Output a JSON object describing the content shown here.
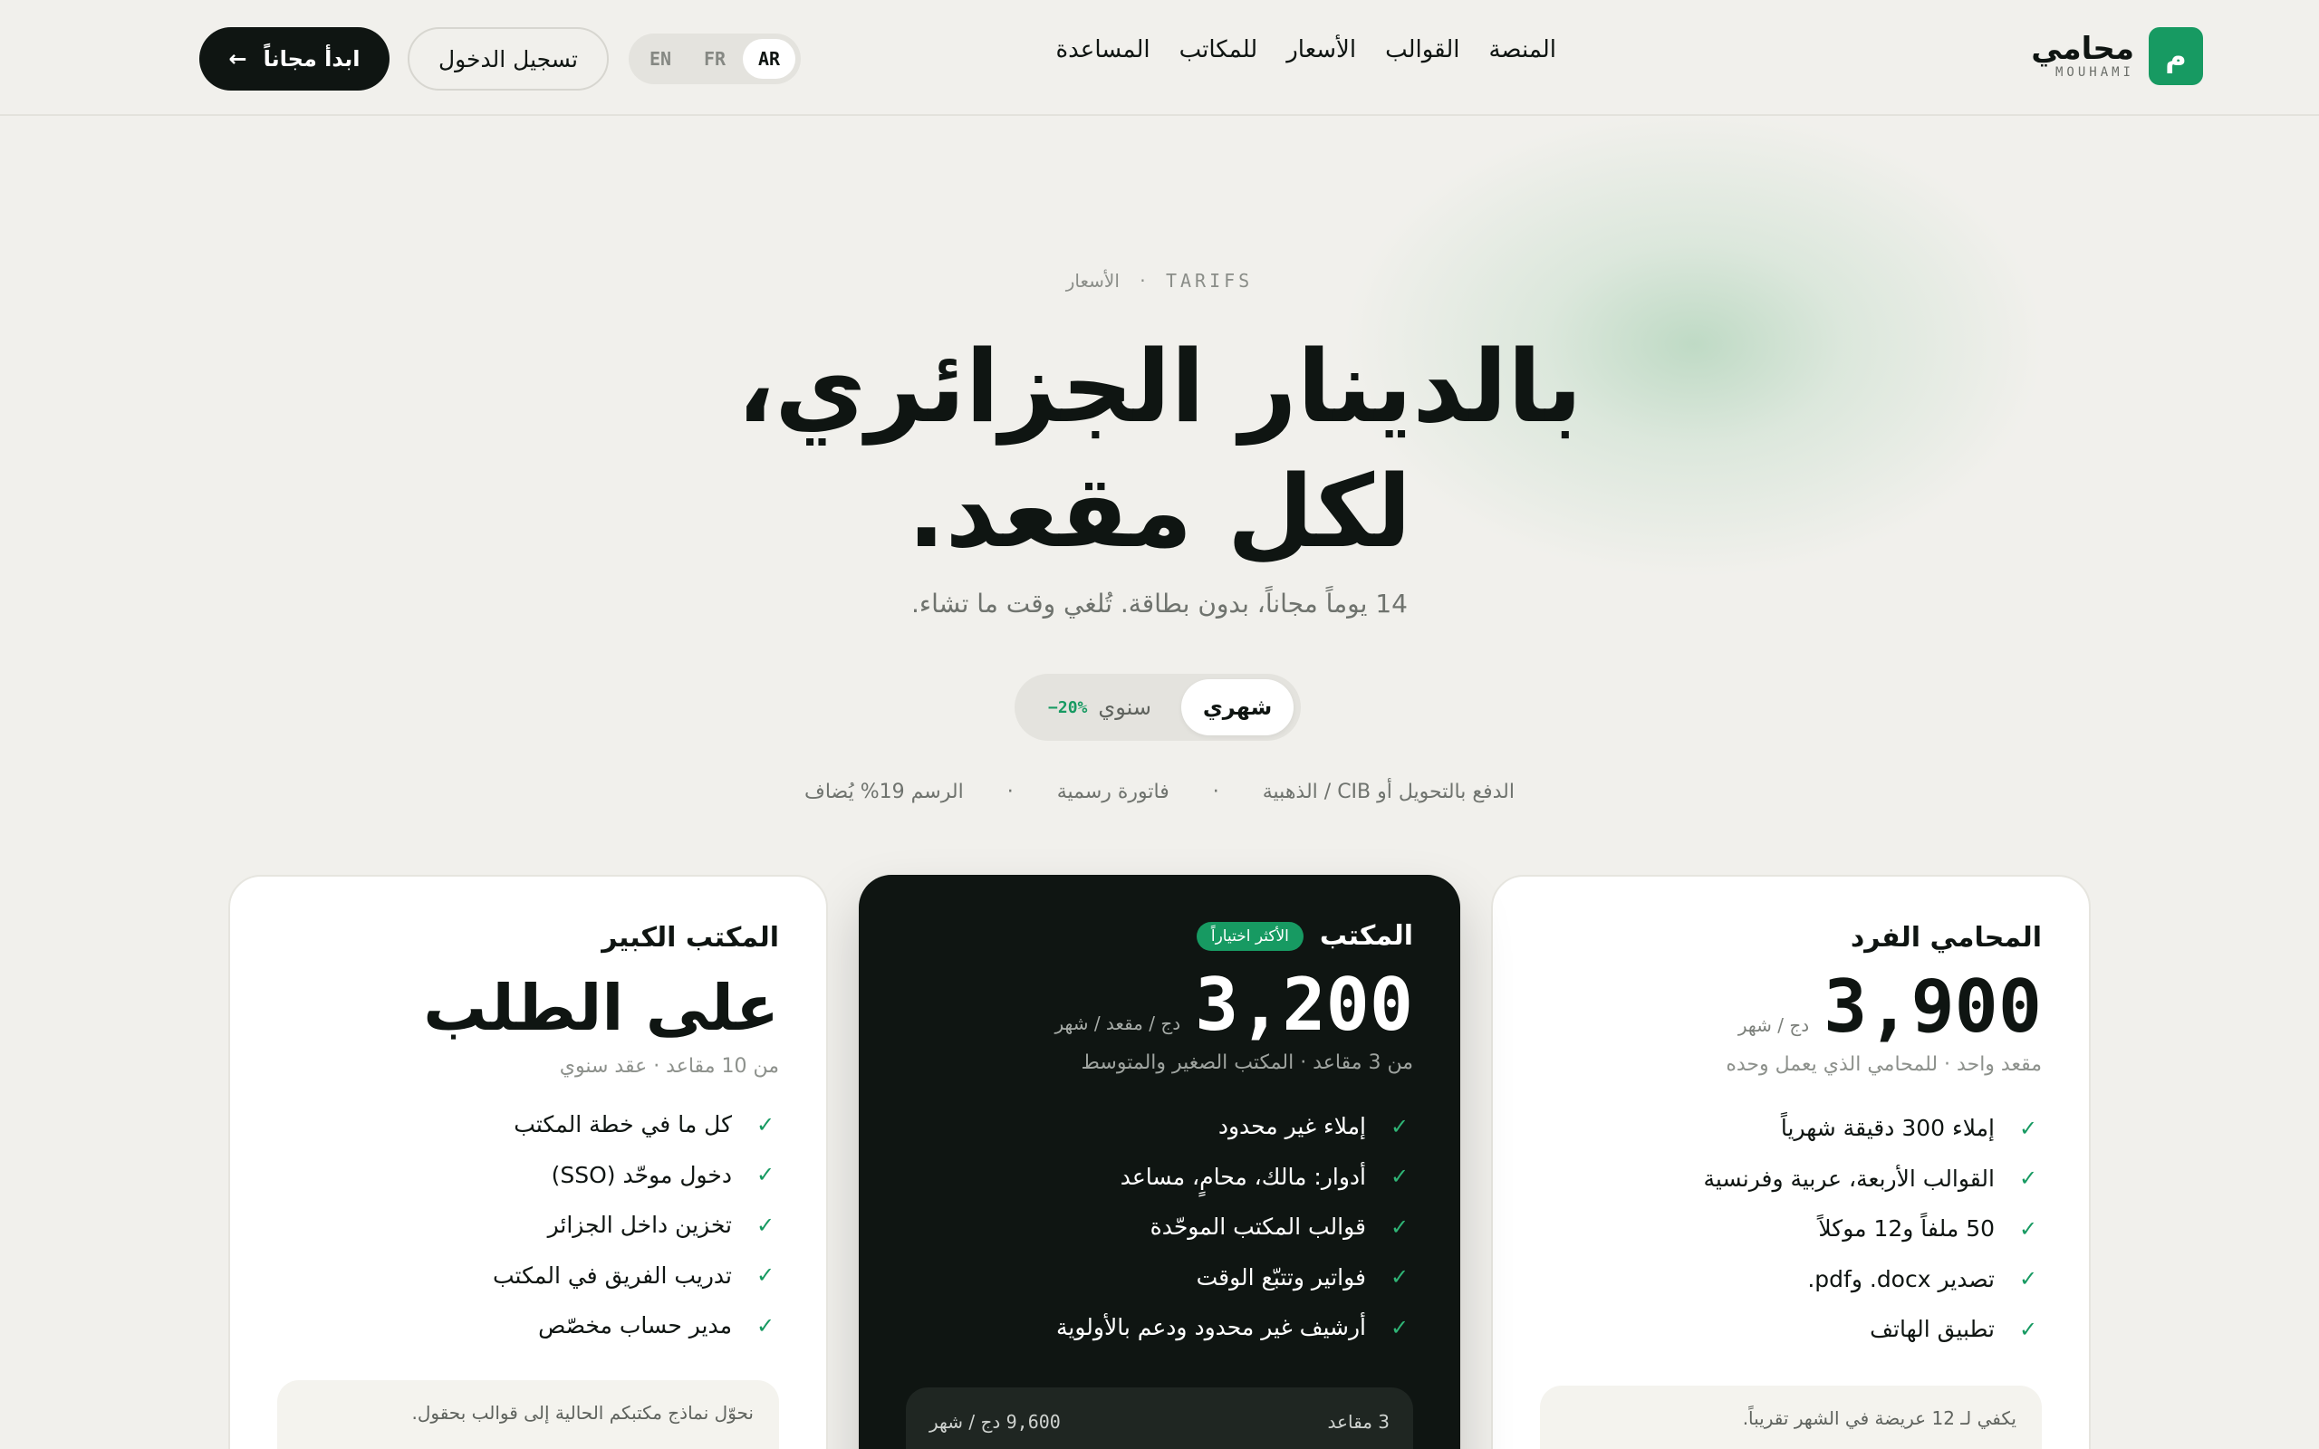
{
  "nav": {
    "logo_mark": "م",
    "logo_ar": "محامي",
    "logo_latin": "MOUHAMI",
    "menu": [
      "المنصة",
      "القوالب",
      "الأسعار",
      "للمكاتب",
      "المساعدة"
    ],
    "languages": [
      "EN",
      "FR",
      "AR"
    ],
    "active_language": "AR",
    "login_label": "تسجيل الدخول",
    "start_label": "ابدأ مجاناً",
    "start_arrow": "←"
  },
  "hero": {
    "eyebrow_en": "TARIFS",
    "eyebrow_sep": "·",
    "eyebrow_ar": "الأسعار",
    "headline_line1": "بالدينار الجزائري،",
    "headline_line2": "لكل مقعد.",
    "subtitle": "14 يوماً مجاناً، بدون بطاقة. تُلغي وقت ما تشاء."
  },
  "billing_toggle": {
    "monthly": "شهري",
    "yearly": "سنوي",
    "yearly_discount": "‎−20%",
    "selected": "شهري"
  },
  "facts": [
    "الدفع بالتحويل أو CIB / الذهبية",
    "·",
    "فاتورة رسمية",
    "·",
    "الرسم 19% يُضاف"
  ],
  "plans": [
    {
      "name": "المحامي الفرد",
      "price": "3,900",
      "unit": "دج / شهر",
      "desc": "مقعد واحد · للمحامي الذي يعمل وحده",
      "features": [
        "إملاء 300 دقيقة شهرياً",
        "القوالب الأربعة، عربية وفرنسية",
        "50 ملفاً و12 موكلاً",
        "تصدير docx. وpdf.",
        "تطبيق الهاتف"
      ],
      "note": "يكفي لـ 12 عريضة في الشهر تقريباً."
    },
    {
      "name": "المكتب",
      "badge": "الأكثر اختياراً",
      "price": "3,200",
      "unit": "دج / مقعد / شهر",
      "desc": "من 3 مقاعد · المكتب الصغير والمتوسط",
      "features": [
        "إملاء غير محدود",
        "أدوار: مالك، محامٍ، مساعد",
        "قوالب المكتب الموحّدة",
        "فواتير وتتبّع الوقت",
        "أرشيف غير محدود ودعم بالأولوية"
      ],
      "note_seats": "3 مقاعد",
      "note_price": "9,600",
      "note_unit": "دج / شهر"
    },
    {
      "name": "المكتب الكبير",
      "price_text": "على الطلب",
      "desc": "من 10 مقاعد · عقد سنوي",
      "features": [
        "كل ما في خطة المكتب",
        "دخول موحّد (SSO)",
        "تخزين داخل الجزائر",
        "تدريب الفريق في المكتب",
        "مدير حساب مخصّص"
      ],
      "note": "نحوّل نماذج مكتبكم الحالية إلى قوالب بحقول."
    }
  ],
  "colors": {
    "accent": "#179a62",
    "ink": "#0f1512",
    "background": "#f1f0ec"
  }
}
